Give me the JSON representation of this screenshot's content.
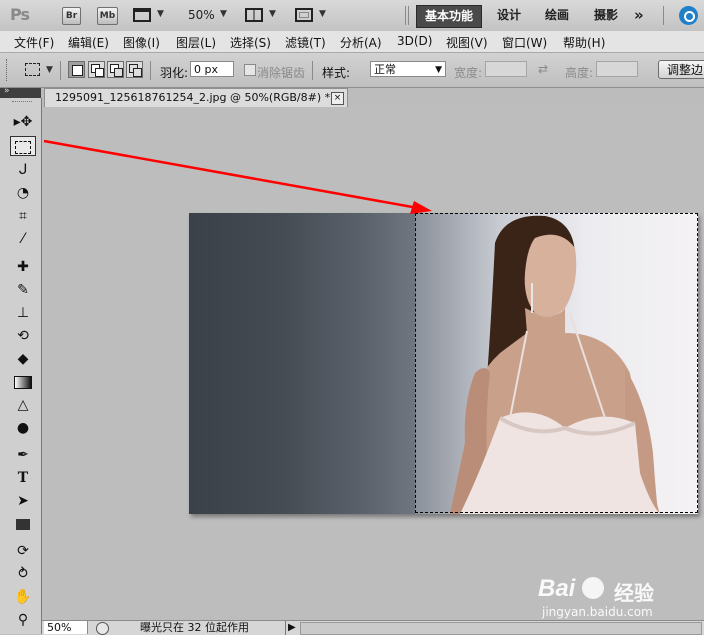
{
  "app": {
    "logo": "Ps",
    "bridge_label": "Br",
    "minibridge_label": "Mb",
    "zoom": "50%",
    "workspaces": [
      "基本功能",
      "设计",
      "绘画",
      "摄影"
    ],
    "more": "»"
  },
  "menu": [
    "文件(F)",
    "编辑(E)",
    "图像(I)",
    "图层(L)",
    "选择(S)",
    "滤镜(T)",
    "分析(A)",
    "3D(D)",
    "视图(V)",
    "窗口(W)",
    "帮助(H)"
  ],
  "options": {
    "feather_label": "羽化:",
    "feather_value": "0 px",
    "antialias_label": "消除锯齿",
    "style_label": "样式:",
    "style_value": "正常",
    "width_label": "宽度:",
    "height_label": "高度:",
    "refine_label": "调整边"
  },
  "document": {
    "tab_title": "1295091_125618761254_2.jpg @ 50%(RGB/8#) *",
    "close_glyph": "×"
  },
  "status": {
    "zoom": "50%",
    "text": "曝光只在 32 位起作用"
  },
  "watermark": {
    "brand": "Bai",
    "brand2": "经验",
    "domain": "jingyan.baidu.com"
  },
  "colors": {
    "annotation_arrow": "#ff0000",
    "active_workspace": "#4a4a4a"
  },
  "icons": {
    "tools": [
      "move-icon",
      "rect-marquee-icon",
      "lasso-icon",
      "quick-select-icon",
      "crop-icon",
      "eyedropper-icon",
      "healing-brush-icon",
      "brush-icon",
      "clone-stamp-icon",
      "history-brush-icon",
      "eraser-icon",
      "gradient-icon",
      "blur-icon",
      "dodge-icon",
      "pen-icon",
      "type-icon",
      "path-select-icon",
      "shape-icon",
      "3d-rotate-icon",
      "3d-orbit-icon",
      "hand-icon",
      "zoom-icon"
    ]
  }
}
